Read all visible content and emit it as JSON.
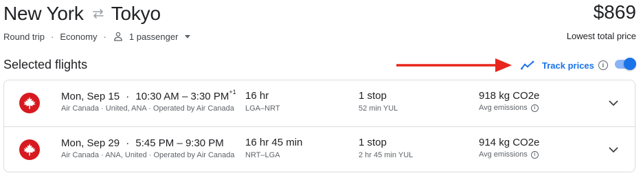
{
  "header": {
    "origin": "New York",
    "destination": "Tokyo",
    "price": "$869",
    "price_label": "Lowest total price"
  },
  "meta": {
    "trip_type": "Round trip",
    "cabin": "Economy",
    "passengers": "1 passenger",
    "separator": "·"
  },
  "section": {
    "title": "Selected flights"
  },
  "track_prices": {
    "label": "Track prices",
    "info": "i",
    "enabled": true
  },
  "colors": {
    "accent": "#1a73e8",
    "annotation_arrow": "#e8261c",
    "airline_brand": "#d71920"
  },
  "flights": [
    {
      "date": "Mon, Sep 15",
      "separator": "·",
      "time_range": "10:30 AM – 3:30 PM",
      "day_offset": "+1",
      "airline": "Air Canada · United, ANA · Operated by Air Canada",
      "duration": "16 hr",
      "airports": "LGA–NRT",
      "stops": "1 stop",
      "layover": "52 min YUL",
      "co2": "918 kg CO2e",
      "emissions": "Avg emissions",
      "info": "i"
    },
    {
      "date": "Mon, Sep 29",
      "separator": "·",
      "time_range": "5:45 PM – 9:30 PM",
      "day_offset": "",
      "airline": "Air Canada · ANA, United · Operated by Air Canada",
      "duration": "16 hr 45 min",
      "airports": "NRT–LGA",
      "stops": "1 stop",
      "layover": "2 hr 45 min YUL",
      "co2": "914 kg CO2e",
      "emissions": "Avg emissions",
      "info": "i"
    }
  ]
}
